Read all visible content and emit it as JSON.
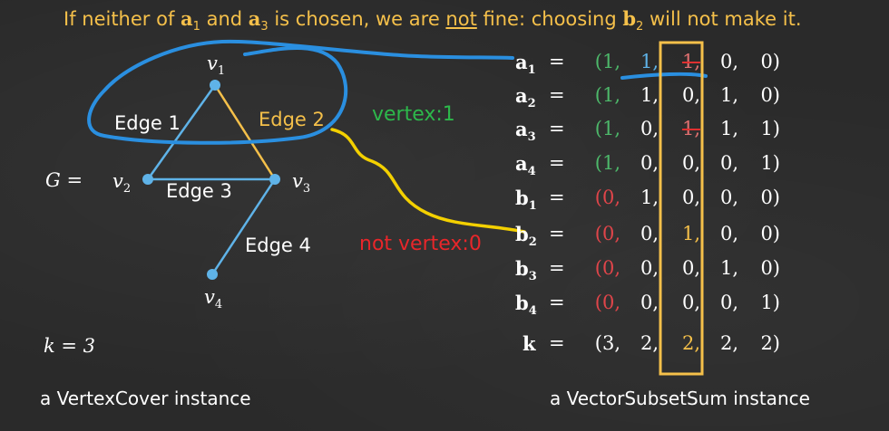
{
  "headline": {
    "prefix": "If neither of ",
    "a": "a",
    "sub1": "1",
    "and": " and ",
    "sub3": "3",
    "middle": " is chosen, we are ",
    "not": "not",
    "after": " fine: choosing ",
    "b": "b",
    "sub2": "2",
    "end": " will not make it."
  },
  "graph": {
    "g_label": "G =",
    "vertices": [
      {
        "name": "v",
        "sub": "1"
      },
      {
        "name": "v",
        "sub": "2"
      },
      {
        "name": "v",
        "sub": "3"
      },
      {
        "name": "v",
        "sub": "4"
      }
    ],
    "edges": [
      "Edge 1",
      "Edge 2",
      "Edge 3",
      "Edge 4"
    ],
    "k_label": "k = 3"
  },
  "notes": {
    "vertex_one": "vertex:1",
    "not_vertex_zero": "not vertex:0"
  },
  "vectors": [
    {
      "name": "a",
      "sub": "1",
      "values": [
        "(1,",
        "1,",
        "1,",
        "0,",
        "0)"
      ]
    },
    {
      "name": "a",
      "sub": "2",
      "values": [
        "(1,",
        "1,",
        "0,",
        "1,",
        "0)"
      ]
    },
    {
      "name": "a",
      "sub": "3",
      "values": [
        "(1,",
        "0,",
        "1,",
        "1,",
        "1)"
      ]
    },
    {
      "name": "a",
      "sub": "4",
      "values": [
        "(1,",
        "0,",
        "0,",
        "0,",
        "1)"
      ]
    },
    {
      "name": "b",
      "sub": "1",
      "values": [
        "(0,",
        "1,",
        "0,",
        "0,",
        "0)"
      ]
    },
    {
      "name": "b",
      "sub": "2",
      "values": [
        "(0,",
        "0,",
        "1,",
        "0,",
        "0)"
      ]
    },
    {
      "name": "b",
      "sub": "3",
      "values": [
        "(0,",
        "0,",
        "0,",
        "1,",
        "0)"
      ]
    },
    {
      "name": "b",
      "sub": "4",
      "values": [
        "(0,",
        "0,",
        "0,",
        "0,",
        "1)"
      ]
    },
    {
      "name": "k",
      "sub": "",
      "values": [
        "(3,",
        "2,",
        "2,",
        "2,",
        "2)"
      ]
    }
  ],
  "captions": {
    "left": "a VertexCover instance",
    "right": "a VectorSubsetSum instance"
  },
  "colors": {
    "yellow": "#f5c04a",
    "blue": "#2a8fe0",
    "green": "#2db84b",
    "red": "#e8262a"
  }
}
